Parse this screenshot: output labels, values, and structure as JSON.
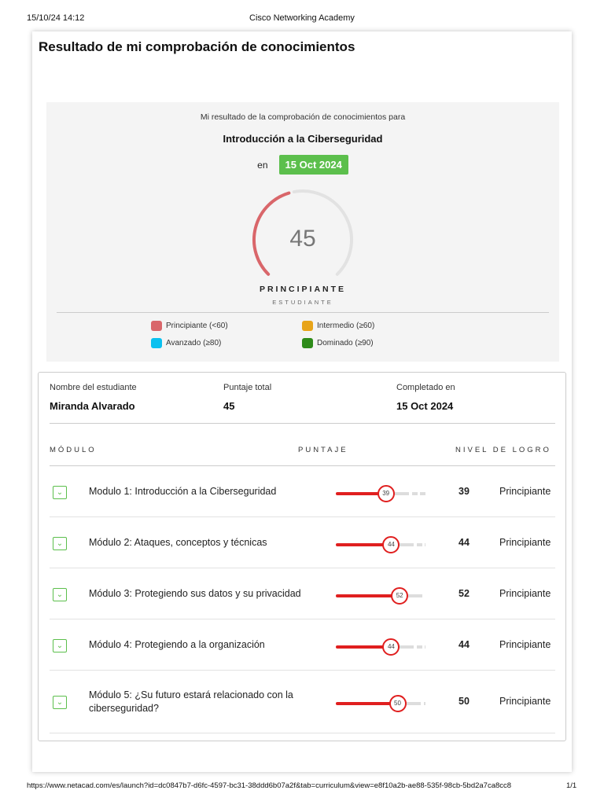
{
  "header": {
    "datetime": "15/10/24 14:12",
    "title": "Cisco Networking Academy"
  },
  "footer": {
    "url": "https://www.netacad.com/es/launch?id=dc0847b7-d6fc-4597-bc31-38ddd6b07a2f&tab=curriculum&view=e8f10a2b-ae88-535f-98cb-5bd2a7ca8cc8",
    "page": "1/1"
  },
  "page_title": "Resultado de mi comprobación de conocimientos",
  "summary": {
    "intro": "Mi resultado de la comprobación de conocimientos para",
    "course": "Introducción a la Ciberseguridad",
    "on": "en",
    "date": "15 Oct 2024",
    "score": "45",
    "score_value": 45,
    "level": "PRINCIPIANTE",
    "role": "ESTUDIANTE",
    "legend": [
      {
        "label": "Principiante (<60)",
        "color": "#d9666a"
      },
      {
        "label": "Intermedio (≥60)",
        "color": "#e8a419"
      },
      {
        "label": "Avanzado (≥80)",
        "color": "#0bc0ef"
      },
      {
        "label": "Dominado (≥90)",
        "color": "#2e8b1a"
      }
    ]
  },
  "info": {
    "student_label": "Nombre del estudiante",
    "student": "Miranda Alvarado",
    "total_label": "Puntaje total",
    "total": "45",
    "completed_label": "Completado en",
    "completed": "15 Oct 2024"
  },
  "table": {
    "headers": [
      "MÓDULO",
      "PUNTAJE",
      "NIVEL DE LOGRO"
    ],
    "rows": [
      {
        "name": "Modulo 1: Introducción a la Ciberseguridad",
        "score": "39",
        "value": 39,
        "level": "Principiante"
      },
      {
        "name": "Módulo 2: Ataques, conceptos y técnicas",
        "score": "44",
        "value": 44,
        "level": "Principiante"
      },
      {
        "name": "Módulo 3: Protegiendo sus datos y su privacidad",
        "score": "52",
        "value": 52,
        "level": "Principiante"
      },
      {
        "name": "Módulo 4: Protegiendo a la organización",
        "score": "44",
        "value": 44,
        "level": "Principiante"
      },
      {
        "name": "Módulo 5: ¿Su futuro estará relacionado con la ciberseguridad?",
        "score": "50",
        "value": 50,
        "level": "Principiante"
      }
    ]
  }
}
